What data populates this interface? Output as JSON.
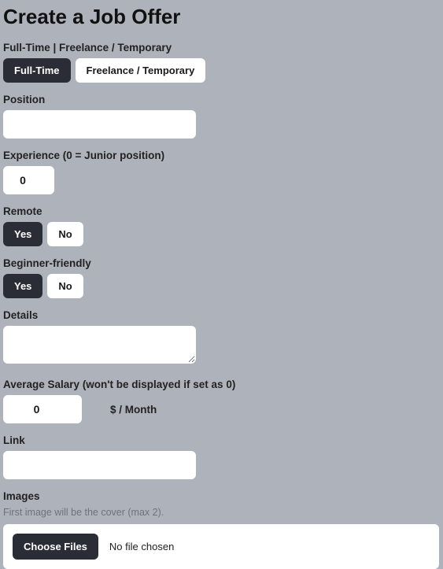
{
  "page_title": "Create a Job Offer",
  "job_type": {
    "label": "Full-Time | Freelance / Temporary",
    "options": {
      "fulltime": "Full-Time",
      "freelance": "Freelance / Temporary"
    },
    "selected": "fulltime"
  },
  "position": {
    "label": "Position",
    "value": ""
  },
  "experience": {
    "label": "Experience (0 = Junior position)",
    "value": "0"
  },
  "remote": {
    "label": "Remote",
    "options": {
      "yes": "Yes",
      "no": "No"
    },
    "selected": "yes"
  },
  "beginner": {
    "label": "Beginner-friendly",
    "options": {
      "yes": "Yes",
      "no": "No"
    },
    "selected": "yes"
  },
  "details": {
    "label": "Details",
    "value": ""
  },
  "salary": {
    "label": "Average Salary (won't be displayed if set as 0)",
    "value": "0",
    "unit": "$ / Month"
  },
  "link": {
    "label": "Link",
    "value": ""
  },
  "images": {
    "label": "Images",
    "hint": "First image will be the cover (max 2).",
    "choose_label": "Choose Files",
    "status": "No file chosen"
  }
}
